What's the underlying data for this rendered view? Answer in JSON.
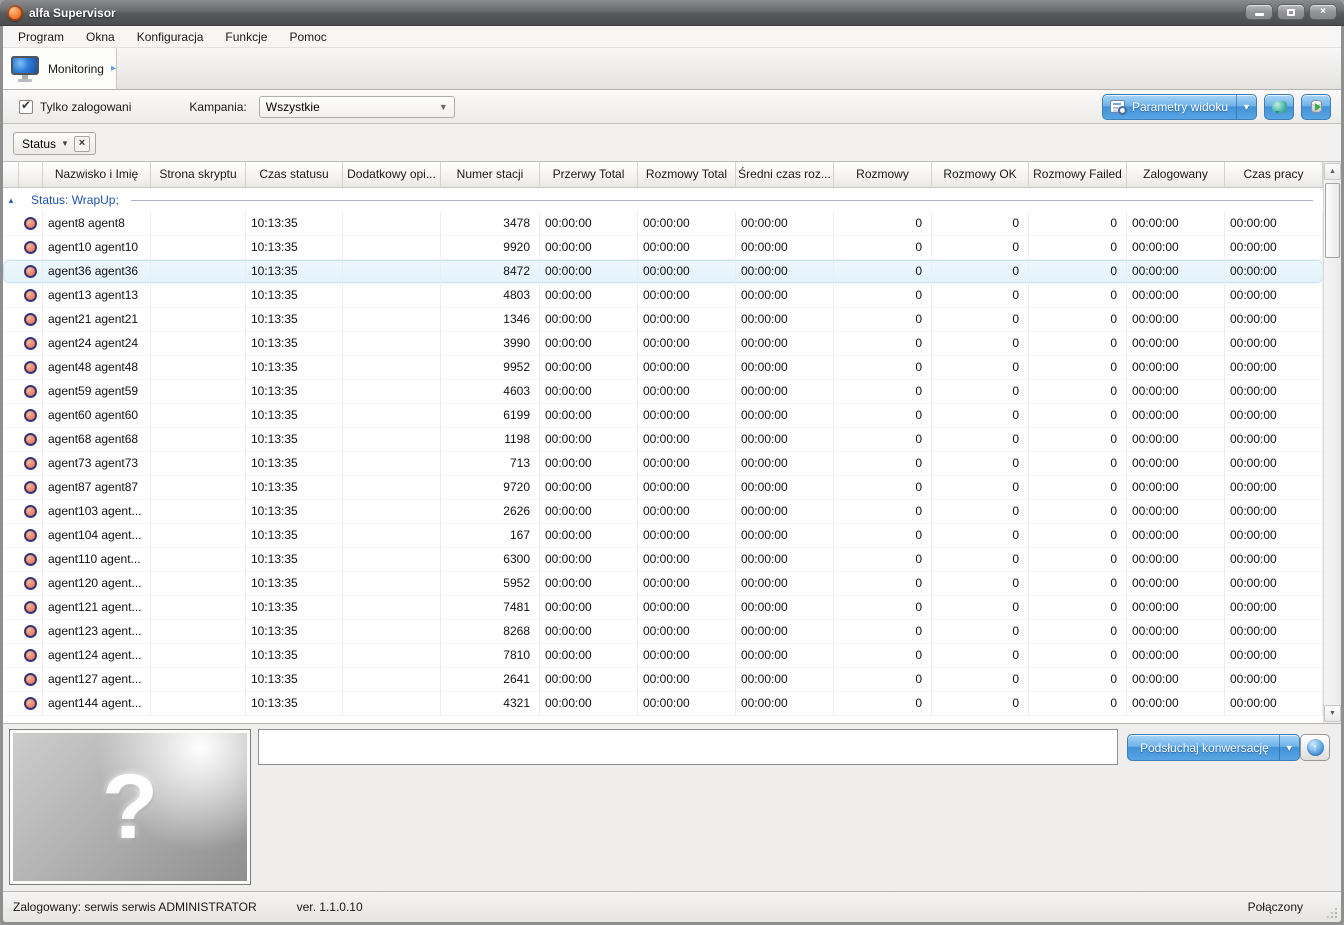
{
  "window": {
    "title": "alfa Supervisor"
  },
  "menu": {
    "items": [
      {
        "label": "Program"
      },
      {
        "label": "Okna"
      },
      {
        "label": "Konfiguracja"
      },
      {
        "label": "Funkcje"
      },
      {
        "label": "Pomoc"
      }
    ]
  },
  "toolbar": {
    "monitoring_label": "Monitoring"
  },
  "filter": {
    "only_logged_label": "Tylko zalogowani",
    "only_logged_checked": true,
    "campaign_label": "Kampania:",
    "campaign_value": "Wszystkie",
    "view_params_label": "Parametry widoku"
  },
  "tabs": {
    "active_label": "Status"
  },
  "table": {
    "group_label": "Status: WrapUp;",
    "columns": [
      {
        "key": "expander",
        "label": ""
      },
      {
        "key": "icon",
        "label": ""
      },
      {
        "key": "name",
        "label": "Nazwisko i Imię",
        "align": "left"
      },
      {
        "key": "script_page",
        "label": "Strona skryptu",
        "align": "left"
      },
      {
        "key": "status_time",
        "label": "Czas statusu",
        "align": "left"
      },
      {
        "key": "extra_desc",
        "label": "Dodatkowy opi...",
        "align": "left"
      },
      {
        "key": "station",
        "label": "Numer stacji",
        "align": "right"
      },
      {
        "key": "breaks_total",
        "label": "Przerwy Total",
        "align": "left"
      },
      {
        "key": "calls_total",
        "label": "Rozmowy Total",
        "align": "left"
      },
      {
        "key": "avg_call",
        "label": "Średni czas roz...",
        "align": "left"
      },
      {
        "key": "calls",
        "label": "Rozmowy",
        "align": "right"
      },
      {
        "key": "calls_ok",
        "label": "Rozmowy OK",
        "align": "right"
      },
      {
        "key": "calls_failed",
        "label": "Rozmowy Failed",
        "align": "right"
      },
      {
        "key": "logged_in",
        "label": "Zalogowany",
        "align": "left"
      },
      {
        "key": "work_time",
        "label": "Czas pracy",
        "align": "left"
      }
    ],
    "row_defaults": {
      "script_page": "",
      "status_time": "10:13:35",
      "extra_desc": "",
      "breaks_total": "00:00:00",
      "calls_total": "00:00:00",
      "avg_call": "00:00:00",
      "calls": "0",
      "calls_ok": "0",
      "calls_failed": "0",
      "logged_in": "00:00:00",
      "work_time": "00:00:00"
    },
    "rows": [
      {
        "name": "agent8 agent8",
        "station": "3478"
      },
      {
        "name": "agent10 agent10",
        "station": "9920"
      },
      {
        "name": "agent36 agent36",
        "station": "8472",
        "selected": true
      },
      {
        "name": "agent13 agent13",
        "station": "4803"
      },
      {
        "name": "agent21 agent21",
        "station": "1346"
      },
      {
        "name": "agent24 agent24",
        "station": "3990"
      },
      {
        "name": "agent48 agent48",
        "station": "9952"
      },
      {
        "name": "agent59 agent59",
        "station": "4603"
      },
      {
        "name": "agent60 agent60",
        "station": "6199"
      },
      {
        "name": "agent68 agent68",
        "station": "1198"
      },
      {
        "name": "agent73 agent73",
        "station": "713"
      },
      {
        "name": "agent87 agent87",
        "station": "9720"
      },
      {
        "name": "agent103 agent...",
        "station": "2626"
      },
      {
        "name": "agent104 agent...",
        "station": "167"
      },
      {
        "name": "agent110 agent...",
        "station": "6300"
      },
      {
        "name": "agent120 agent...",
        "station": "5952"
      },
      {
        "name": "agent121 agent...",
        "station": "7481"
      },
      {
        "name": "agent123 agent...",
        "station": "8268"
      },
      {
        "name": "agent124 agent...",
        "station": "7810"
      },
      {
        "name": "agent127 agent...",
        "station": "2641"
      },
      {
        "name": "agent144 agent...",
        "station": "4321"
      }
    ]
  },
  "bottom": {
    "input_value": "",
    "listen_button_label": "Podsłuchaj konwersację"
  },
  "statusbar": {
    "logged_in": "Zalogowany: serwis serwis ADMINISTRATOR",
    "version": "ver. 1.1.0.10",
    "connection": "Połączony"
  },
  "icons": {
    "close_glyph": "×",
    "dropdown_glyph": "▼",
    "expand_glyph": "▸",
    "collapse_glyph": "▲",
    "check_glyph": "✔",
    "scroll_up_glyph": "▲",
    "scroll_down_glyph": "▼",
    "question_glyph": "?",
    "up_arrow_glyph": "↑"
  },
  "colors": {
    "accent_blue": "#4a97d9",
    "selection_blue": "#e7f4fc",
    "group_text_blue": "#2051a8",
    "agent_dot_orange": "#ed8465",
    "titlebar_gray": "#58595b"
  }
}
